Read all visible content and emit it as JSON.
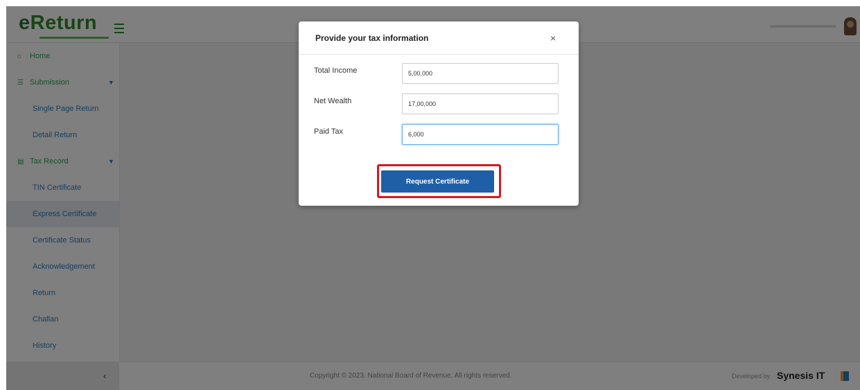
{
  "header": {
    "logo_prefix": "e",
    "logo_name": "Return"
  },
  "sidebar": {
    "items": [
      {
        "label": "Home",
        "icon": "home-icon"
      },
      {
        "label": "Submission",
        "icon": "submission-icon"
      },
      {
        "label": "Single Page Return"
      },
      {
        "label": "Detail Return"
      },
      {
        "label": "Tax Record",
        "icon": "tax-record-icon"
      },
      {
        "label": "TIN Certificate"
      },
      {
        "label": "Express Certificate",
        "active": true
      },
      {
        "label": "Certificate Status"
      },
      {
        "label": "Acknowledgement"
      },
      {
        "label": "Return"
      },
      {
        "label": "Challan"
      },
      {
        "label": "History"
      }
    ],
    "collapse_icon": "‹"
  },
  "modal": {
    "title": "Provide your tax information",
    "close_icon": "×",
    "fields": [
      {
        "label": "Total Income",
        "value": "5,00,000"
      },
      {
        "label": "Net Wealth",
        "value": "17,00,000"
      },
      {
        "label": "Paid Tax",
        "value": "6,000"
      }
    ],
    "submit_label": "Request Certificate"
  },
  "footer": {
    "copyright": "Copyright © 2023. National Board of Revenue. All rights reserved.",
    "developed_by": "Developed by",
    "developer": "Synesis IT"
  },
  "colors": {
    "brand_green": "#2f8a2f",
    "link_blue": "#2b7bbf",
    "button_blue": "#1f5fa8",
    "highlight_red": "#e0141e"
  }
}
